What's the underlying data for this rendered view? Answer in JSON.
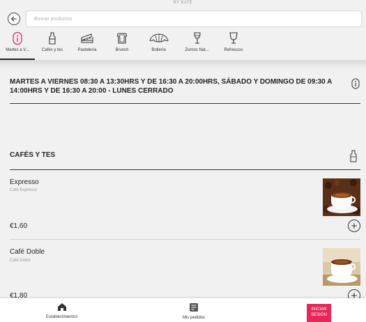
{
  "brand": "BY KATE",
  "search": {
    "placeholder": "Buscar productos"
  },
  "categories": [
    {
      "label": "Martes a V...",
      "icon": "info-icon",
      "active": true
    },
    {
      "label": "Cafés y tes",
      "icon": "bottle-icon"
    },
    {
      "label": "Pastelería",
      "icon": "cake-icon"
    },
    {
      "label": "Brunch",
      "icon": "toast-icon"
    },
    {
      "label": "Bollería",
      "icon": "croissant-icon"
    },
    {
      "label": "Zumos Nat...",
      "icon": "wine-glass-icon"
    },
    {
      "label": "Refrescos",
      "icon": "cocktail-glass-icon"
    }
  ],
  "schedule": {
    "text": "MARTES A VIERNES 08:30 A 13:30HRS Y DE 16:30 A 20:00HRS, SÁBADO Y DOMINGO DE 09:30 A 14:00HRS Y DE 16:30 A 20:00 - LUNES CERRADO"
  },
  "section": {
    "title": "CAFÉS Y TES"
  },
  "products": [
    {
      "name": "Expresso",
      "subtitle": "Café Expresso",
      "price": "€1,60"
    },
    {
      "name": "Café Doble",
      "subtitle": "Café Doble",
      "price": "€1,80"
    }
  ],
  "bottom_nav": {
    "establishments": "Establecimientos",
    "orders": "Mis pedidos",
    "login_line1": "INICIAR",
    "login_line2": "SESIÓN"
  },
  "colors": {
    "accent": "#e8265a",
    "background": "#f1f1f1",
    "text": "#222222"
  }
}
